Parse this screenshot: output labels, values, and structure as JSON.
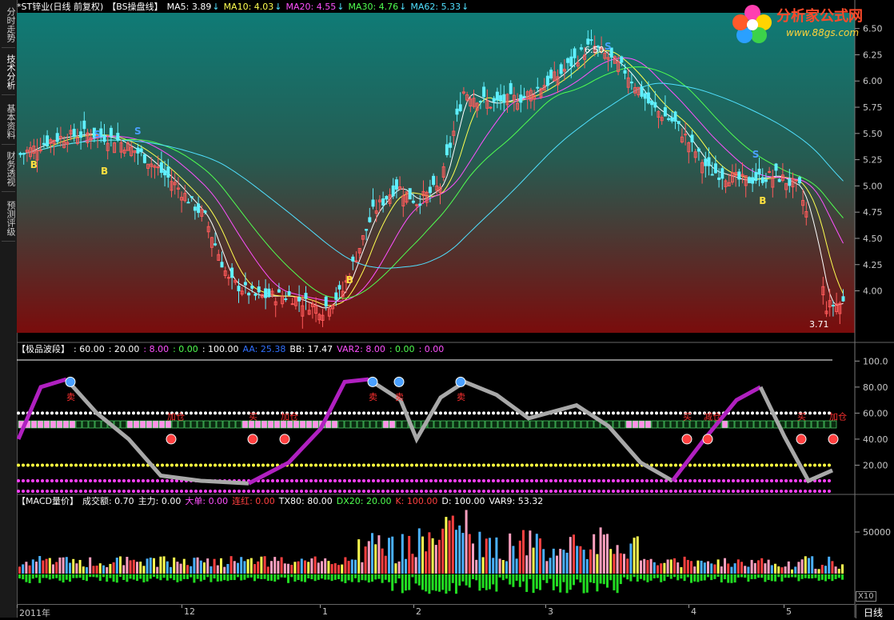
{
  "tabs": [
    {
      "label": "分时走势",
      "active": false
    },
    {
      "label": "技术分析",
      "active": true
    },
    {
      "label": "基本资料",
      "active": false
    },
    {
      "label": "财务透视",
      "active": false
    },
    {
      "label": "预测评级",
      "active": false
    }
  ],
  "price_header": {
    "title": "*ST锌业(日线 前复权)",
    "formula": "【BS操盘线】",
    "ma": [
      {
        "label": "MA5: 3.89",
        "arrow": "↓",
        "color": "#ffffff"
      },
      {
        "label": "MA10: 4.03",
        "arrow": "↓",
        "color": "#ffff50"
      },
      {
        "label": "MA20: 4.55",
        "arrow": "↓",
        "color": "#ff50ff"
      },
      {
        "label": "MA30: 4.76",
        "arrow": "↓",
        "color": "#50ff50"
      },
      {
        "label": "MA62: 5.33",
        "arrow": "↓",
        "color": "#50e0ff"
      }
    ]
  },
  "logo": {
    "name": "分析家公式网",
    "url": "www.88gs.com"
  },
  "price_scale": [
    "6.50",
    "6.25",
    "6.00",
    "5.75",
    "5.50",
    "5.25",
    "5.00",
    "4.75",
    "4.50",
    "4.25",
    "4.00"
  ],
  "annotations": {
    "high": "6.50",
    "low": "3.71",
    "sell": "S",
    "buy": "B"
  },
  "indicator_header": {
    "name": "【极品波段】",
    "values": [
      {
        "label": ": 60.00",
        "color": "#ffffff"
      },
      {
        "label": ": 20.00",
        "color": "#ffffff"
      },
      {
        "label": ": 8.00",
        "color": "#ff50ff"
      },
      {
        "label": ": 0.00",
        "color": "#50ff50"
      },
      {
        "label": ": 100.00",
        "color": "#ffffff"
      },
      {
        "label": "AA: 25.38",
        "color": "#3070ff"
      },
      {
        "label": "BB: 17.47",
        "color": "#ffffff"
      },
      {
        "label": "VAR2: 8.00",
        "color": "#ff50ff"
      },
      {
        "label": ": 0.00",
        "color": "#50ff50"
      },
      {
        "label": ": 0.00",
        "color": "#ff50ff"
      }
    ]
  },
  "indicator_scale": [
    "100.0",
    "80.00",
    "60.00",
    "40.00",
    "20.00"
  ],
  "indicator_labels": {
    "sell": "卖",
    "buy": "买",
    "add": "加仓",
    "reduce": "减仓"
  },
  "volume_header": {
    "name": "【MACD量价】",
    "values": [
      {
        "label": "成交额: 0.70",
        "color": "#ffffff"
      },
      {
        "label": "主力: 0.00",
        "color": "#ffffff"
      },
      {
        "label": "大单: 0.00",
        "color": "#ff50ff"
      },
      {
        "label": "连红: 0.00",
        "color": "#ff4040"
      },
      {
        "label": "TX80: 80.00",
        "color": "#ffffff"
      },
      {
        "label": "DX20: 20.00",
        "color": "#50ff50"
      },
      {
        "label": "K: 100.00",
        "color": "#ff4040"
      },
      {
        "label": "D: 100.00",
        "color": "#ffffff"
      },
      {
        "label": "VAR9: 53.32",
        "color": "#ffffff"
      }
    ]
  },
  "volume_scale": [
    "50000"
  ],
  "x10": "X10",
  "dates": [
    "2011年",
    "12",
    "1",
    "2",
    "3",
    "4",
    "5"
  ],
  "period": "日线"
}
